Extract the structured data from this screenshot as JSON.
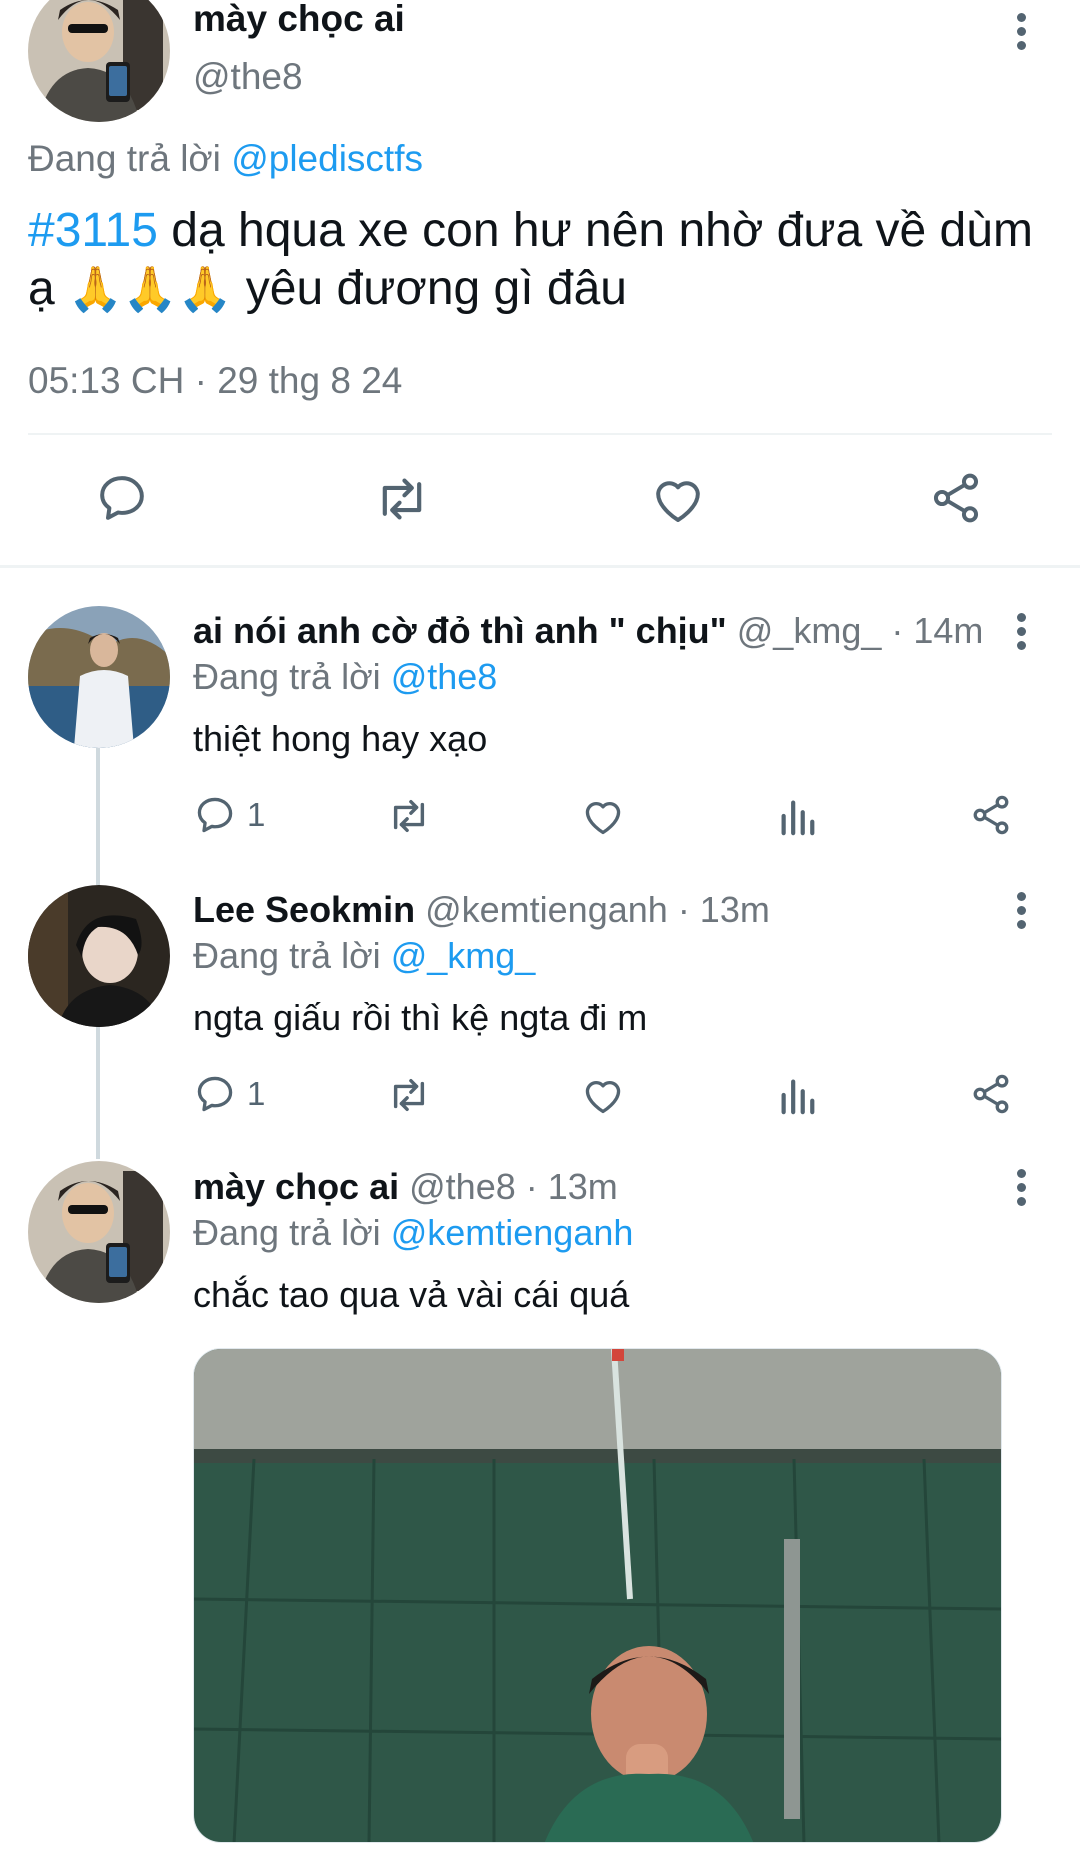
{
  "main_tweet": {
    "author_name": "mày chọc ai",
    "author_handle": "@the8",
    "reply_prefix": "Đang trả lời",
    "reply_to": "@pledisctfs",
    "hashtag": "#3115",
    "text_part1": "dạ hqua xe con hư nên nhờ đưa về dùm ạ",
    "emoji": "🙏",
    "text_part2": "yêu đương gì đâu",
    "timestamp": "05:13 CH · 29 thg 8 24",
    "actions": {
      "reply_icon": "speech-bubble-icon",
      "retweet_icon": "retweet-icon",
      "like_icon": "heart-icon",
      "share_icon": "share-icon"
    }
  },
  "replies": [
    {
      "name": "ai nói anh cờ đỏ thì anh \" chịu\"",
      "handle": "@_kmg_",
      "time": "· 14m",
      "reply_prefix": "Đang trả lời",
      "reply_to": "@the8",
      "text": "thiệt hong hay xạo",
      "reply_count": "1"
    },
    {
      "name": "Lee Seokmin",
      "handle": "@kemtienganh",
      "time": "· 13m",
      "reply_prefix": "Đang trả lời",
      "reply_to": "@_kmg_",
      "text": "ngta giấu rồi thì kệ ngta đi m",
      "reply_count": "1"
    },
    {
      "name": "mày chọc ai",
      "handle": "@the8",
      "time": "· 13m",
      "reply_prefix": "Đang trả lời",
      "reply_to": "@kemtienganh",
      "text": "chắc tao qua vả vài cái quá"
    }
  ],
  "colors": {
    "accent": "#1d9bf0",
    "muted": "#6e767d",
    "icon": "#536471",
    "divider": "#eff3f4"
  }
}
